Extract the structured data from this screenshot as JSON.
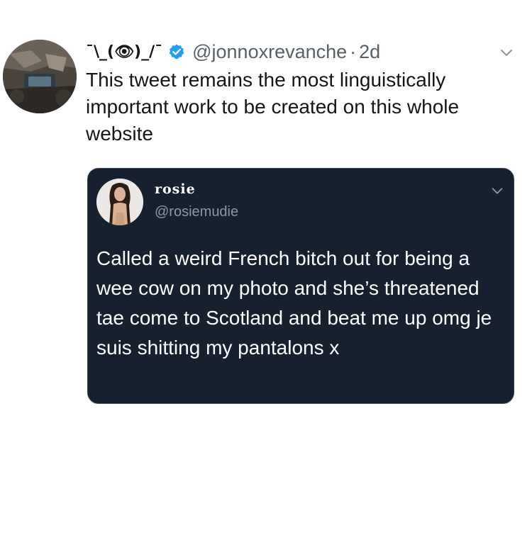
{
  "tweet": {
    "display_name": "¯\\_(👁)_/¯",
    "handle": "@jonnoxrevanche",
    "separator": "·",
    "time": "2d",
    "text": "This tweet remains the most linguistically important work to be created on this whole website",
    "verified": true
  },
  "quoted_tweet": {
    "display_name": "rosie",
    "handle": "@rosiemudie",
    "text": "Called a weird French bitch out for being a wee cow on my photo and she’s threatened tae come to Scotland and beat me up omg je suis shitting my pantalons x"
  },
  "icons": {
    "verified": "verified-badge-icon",
    "menu": "chevron-down-icon"
  },
  "colors": {
    "verified_blue": "#1da1f2",
    "quote_background": "#17202e",
    "secondary_text": "#586069"
  }
}
